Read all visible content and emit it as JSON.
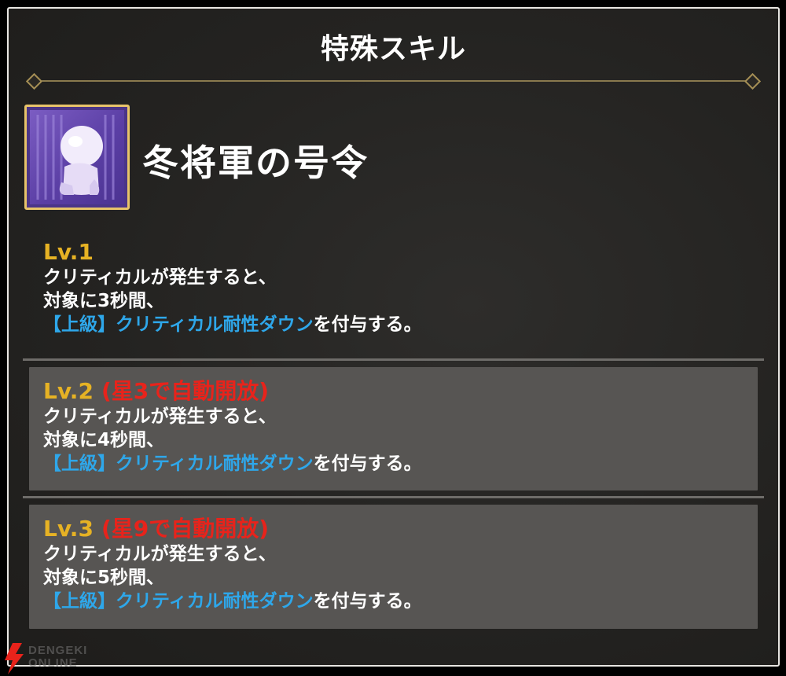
{
  "header": {
    "title": "特殊スキル"
  },
  "skill": {
    "name": "冬将軍の号令",
    "icon": "frozen-figure-icon"
  },
  "levels": [
    {
      "label": "Lv.1",
      "unlock": "",
      "line1": "クリティカルが発生すると、",
      "line2": "対象に3秒間、",
      "effect_prefix": "【上級】",
      "effect_name": "クリティカル耐性ダウン",
      "effect_suffix": "を付与する。"
    },
    {
      "label": "Lv.2",
      "unlock": "(星3で自動開放)",
      "line1": "クリティカルが発生すると、",
      "line2": "対象に4秒間、",
      "effect_prefix": "【上級】",
      "effect_name": "クリティカル耐性ダウン",
      "effect_suffix": "を付与する。"
    },
    {
      "label": "Lv.3",
      "unlock": "(星9で自動開放)",
      "line1": "クリティカルが発生すると、",
      "line2": "対象に5秒間、",
      "effect_prefix": "【上級】",
      "effect_name": "クリティカル耐性ダウン",
      "effect_suffix": "を付与する。"
    }
  ],
  "watermark": {
    "line1": "DENGEKI",
    "line2": "ONLINE"
  },
  "colors": {
    "level_label": "#e6b224",
    "unlock_text": "#e8231b",
    "effect_text": "#2ea7ea",
    "panel_bg": "#242321",
    "locked_box_bg": "#575553"
  }
}
